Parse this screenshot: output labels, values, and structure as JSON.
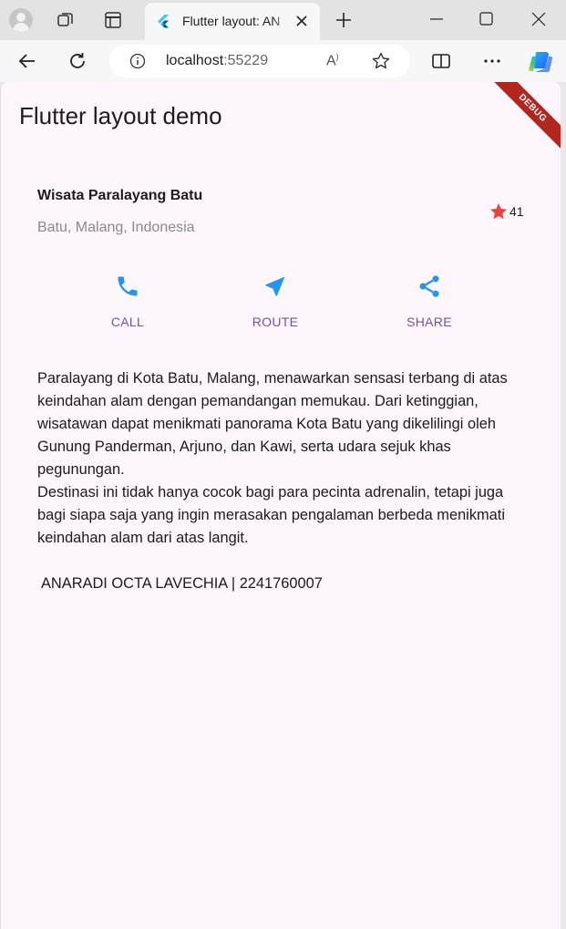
{
  "browser": {
    "tab": {
      "title": "Flutter layout: AN",
      "favicon": "flutter-logo-icon"
    },
    "address_host": "localhost",
    "address_port": ":55229",
    "icons": {
      "profile": "profile-avatar-icon",
      "workspaces": "workspaces-icon",
      "tab_actions": "tab-actions-icon",
      "new_tab": "plus-icon",
      "minimize": "minimize-icon",
      "maximize": "maximize-icon",
      "close": "close-icon",
      "back": "arrow-left-icon",
      "reload": "reload-icon",
      "info": "info-icon",
      "read_aloud": "read-aloud-icon",
      "favorite": "star-outline-icon",
      "split_screen": "split-screen-icon",
      "more": "more-icon",
      "copilot": "copilot-icon"
    }
  },
  "app": {
    "title": "Flutter layout demo",
    "debug_banner": "DEBUG",
    "place": {
      "name": "Wisata Paralayang Batu",
      "location": "Batu, Malang, Indonesia",
      "rating": "41"
    },
    "actions": [
      {
        "label": "CALL",
        "icon": "phone-icon"
      },
      {
        "label": "ROUTE",
        "icon": "navigation-icon"
      },
      {
        "label": "SHARE",
        "icon": "share-icon"
      }
    ],
    "description": [
      "Paralayang di Kota Batu, Malang, menawarkan sensasi terbang di atas keindahan alam dengan pemandangan memukau. Dari ketinggian, wisatawan dapat menikmati panorama Kota Batu yang dikelilingi oleh Gunung Panderman, Arjuno, dan Kawi, serta udara sejuk khas pegunungan.",
      "Destinasi ini tidak hanya cocok bagi para pecinta adrenalin, tetapi juga bagi siapa saja yang ingin merasakan pengalaman berbeda menikmati keindahan alam dari atas langit."
    ],
    "author": "ANARADI OCTA LAVECHIA | 2241760007"
  },
  "colors": {
    "accent": "#2196f3",
    "action_label": "#6e55a3",
    "star": "#f44336",
    "page_bg": "#fdf6fc",
    "debug_banner": "#b3261e"
  }
}
